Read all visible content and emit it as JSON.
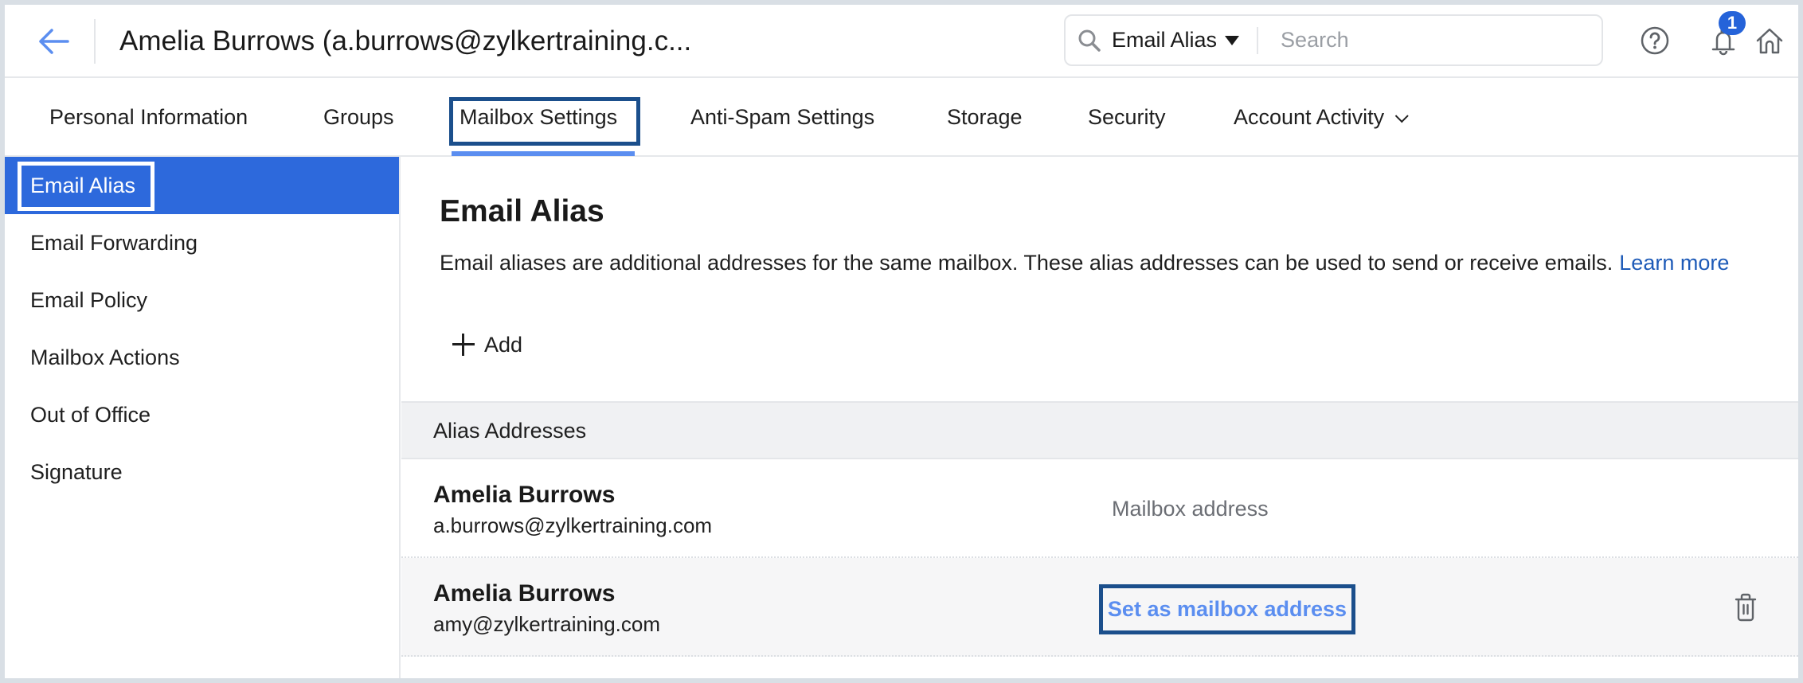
{
  "header": {
    "title": "Amelia Burrows (a.burrows@zylkertraining.c...",
    "back_icon": "arrow-left-icon",
    "search": {
      "scope": "Email Alias",
      "placeholder": "Search",
      "value": ""
    },
    "notification_count": "1"
  },
  "tabs": [
    {
      "label": "Personal Information",
      "active": false
    },
    {
      "label": "Groups",
      "active": false
    },
    {
      "label": "Mailbox Settings",
      "active": true
    },
    {
      "label": "Anti-Spam Settings",
      "active": false
    },
    {
      "label": "Storage",
      "active": false
    },
    {
      "label": "Security",
      "active": false
    },
    {
      "label": "Account Activity",
      "active": false,
      "has_dropdown": true
    }
  ],
  "sidebar": {
    "items": [
      {
        "label": "Email Alias",
        "active": true
      },
      {
        "label": "Email Forwarding",
        "active": false
      },
      {
        "label": "Email Policy",
        "active": false
      },
      {
        "label": "Mailbox Actions",
        "active": false
      },
      {
        "label": "Out of Office",
        "active": false
      },
      {
        "label": "Signature",
        "active": false
      }
    ]
  },
  "main": {
    "title": "Email Alias",
    "description": "Email aliases are additional addresses for the same mailbox. These alias addresses can be used to send or receive emails.",
    "learn_more": "Learn more",
    "add_label": "Add",
    "table": {
      "header": "Alias Addresses",
      "rows": [
        {
          "name": "Amelia Burrows",
          "email": "a.burrows@zylkertraining.com",
          "status": "Mailbox address"
        },
        {
          "name": "Amelia Burrows",
          "email": "amy@zylkertraining.com",
          "action": "Set as mailbox address"
        }
      ]
    }
  },
  "colors": {
    "accent": "#2d69dc",
    "link": "#1e5bb8",
    "focus_outline": "#1b4f8c",
    "tab_underline": "#5b8ef0",
    "badge": "#2563d9"
  }
}
